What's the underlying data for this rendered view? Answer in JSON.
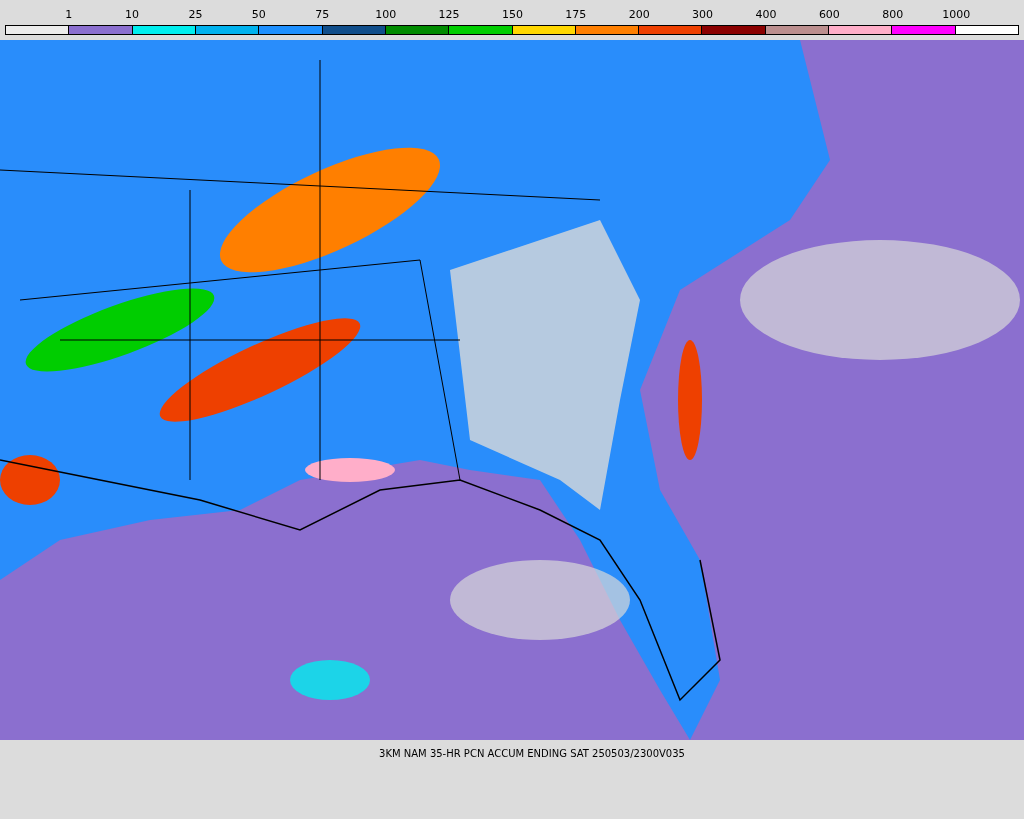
{
  "legend": {
    "labels": [
      "1",
      "10",
      "25",
      "50",
      "75",
      "100",
      "125",
      "150",
      "175",
      "200",
      "300",
      "400",
      "600",
      "800",
      "1000"
    ],
    "swatches": [
      {
        "color": "#ececec"
      },
      {
        "color": "#8b6fcf"
      },
      {
        "color": "#00eeee"
      },
      {
        "color": "#00b2ee"
      },
      {
        "color": "#1e90ff"
      },
      {
        "color": "#104e8b"
      },
      {
        "color": "#008b00"
      },
      {
        "color": "#00cd00"
      },
      {
        "color": "#ffd700"
      },
      {
        "color": "#ff7f00"
      },
      {
        "color": "#ee4000"
      },
      {
        "color": "#8b0000"
      },
      {
        "color": "#bc8f8f"
      },
      {
        "color": "#ffaec9"
      },
      {
        "color": "#ff00ff"
      },
      {
        "color": "#ffffff"
      }
    ]
  },
  "caption": "3KM NAM 35-HR PCN ACCUM ENDING SAT 250503/2300V035"
}
